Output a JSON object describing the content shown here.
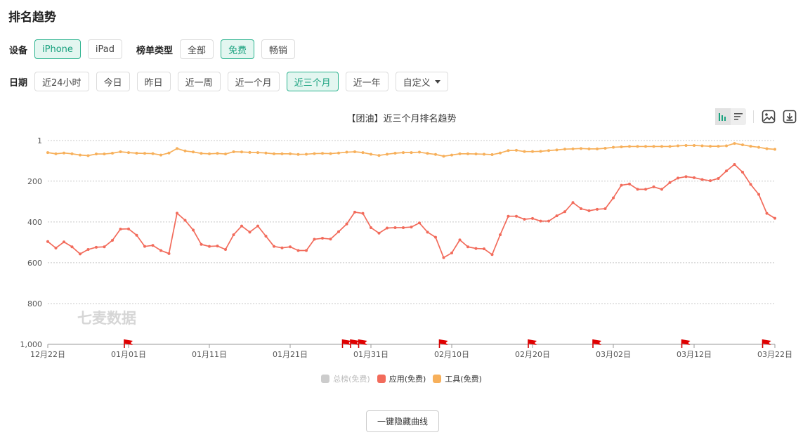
{
  "page_title": "排名趋势",
  "filters": {
    "device_label": "设备",
    "devices": [
      {
        "label": "iPhone",
        "active": true
      },
      {
        "label": "iPad",
        "active": false
      }
    ],
    "list_type_label": "榜单类型",
    "list_types": [
      {
        "label": "全部",
        "active": false
      },
      {
        "label": "免费",
        "active": true
      },
      {
        "label": "畅销",
        "active": false
      }
    ],
    "date_label": "日期",
    "dates": [
      {
        "label": "近24小时",
        "active": false
      },
      {
        "label": "今日",
        "active": false
      },
      {
        "label": "昨日",
        "active": false
      },
      {
        "label": "近一周",
        "active": false
      },
      {
        "label": "近一个月",
        "active": false
      },
      {
        "label": "近三个月",
        "active": true
      },
      {
        "label": "近一年",
        "active": false
      },
      {
        "label": "自定义",
        "active": false,
        "dropdown": true
      }
    ]
  },
  "toolbar": {
    "icons": [
      "bar-view-icon",
      "list-view-icon",
      "image-export-icon",
      "download-icon"
    ]
  },
  "legend": [
    {
      "label": "总榜(免费)",
      "color": "#cccccc",
      "enabled": false
    },
    {
      "label": "应用(免费)",
      "color": "#f26b5b",
      "enabled": true
    },
    {
      "label": "工具(免费)",
      "color": "#f7b05b",
      "enabled": true
    }
  ],
  "hide_curves_label": "一键隐藏曲线",
  "chart_data": {
    "type": "line",
    "title": "【团油】近三个月排名趋势",
    "watermark": "七麦数据",
    "y_axis": {
      "ticks": [
        "1",
        "200",
        "400",
        "600",
        "800",
        "1,000"
      ],
      "range": [
        1,
        1000
      ],
      "inverted": true
    },
    "x_axis": {
      "ticks": [
        "12月22日",
        "01月01日",
        "01月11日",
        "01月21日",
        "01月31日",
        "02月10日",
        "02月20日",
        "03月02日",
        "03月12日",
        "03月22日"
      ],
      "start": "12月22日",
      "days": 90
    },
    "grid": true,
    "legend_position": "bottom",
    "event_flags_days": [
      10,
      37,
      38,
      39,
      49,
      60,
      68,
      79,
      89
    ],
    "series": [
      {
        "name": "应用(免费)",
        "color": "#f26b5b",
        "values": [
          496,
          528,
          498,
          522,
          557,
          535,
          524,
          522,
          490,
          435,
          434,
          465,
          520,
          515,
          540,
          555,
          357,
          392,
          440,
          510,
          520,
          518,
          535,
          463,
          420,
          450,
          420,
          470,
          520,
          527,
          522,
          540,
          540,
          485,
          480,
          484,
          448,
          410,
          352,
          358,
          428,
          455,
          430,
          428,
          428,
          425,
          405,
          450,
          475,
          575,
          552,
          488,
          522,
          530,
          532,
          560,
          463,
          372,
          372,
          387,
          383,
          396,
          396,
          370,
          350,
          305,
          335,
          345,
          338,
          335,
          282,
          220,
          214,
          240,
          240,
          228,
          240,
          207,
          185,
          178,
          183,
          192,
          198,
          187,
          150,
          118,
          156,
          216,
          265,
          358,
          382
        ]
      },
      {
        "name": "工具(免费)",
        "color": "#f7b05b",
        "values": [
          60,
          66,
          62,
          66,
          72,
          75,
          67,
          67,
          63,
          56,
          60,
          63,
          64,
          65,
          72,
          62,
          40,
          52,
          57,
          64,
          66,
          64,
          67,
          56,
          57,
          59,
          60,
          62,
          66,
          66,
          66,
          69,
          68,
          65,
          64,
          65,
          62,
          58,
          56,
          60,
          68,
          74,
          68,
          63,
          60,
          60,
          58,
          64,
          69,
          78,
          72,
          66,
          66,
          67,
          68,
          70,
          62,
          50,
          49,
          55,
          55,
          54,
          50,
          47,
          43,
          42,
          40,
          42,
          42,
          39,
          34,
          32,
          30,
          30,
          30,
          30,
          30,
          30,
          27,
          25,
          25,
          27,
          29,
          29,
          27,
          15,
          22,
          29,
          34,
          41,
          44
        ]
      }
    ]
  }
}
